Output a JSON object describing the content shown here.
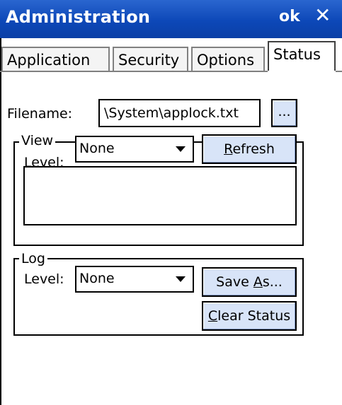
{
  "window": {
    "title": "Administration",
    "ok_label": "ok",
    "close_glyph": "✕"
  },
  "tabs": [
    {
      "label": "Application",
      "active": false
    },
    {
      "label": "Security",
      "active": false
    },
    {
      "label": "Options",
      "active": false
    },
    {
      "label": "Status",
      "active": true
    }
  ],
  "filename": {
    "label": "Filename:",
    "value": "\\System\\applock.txt",
    "browse_label": "..."
  },
  "view": {
    "legend": "View",
    "level_label": "Level:",
    "level_value": "None",
    "refresh_pre": "",
    "refresh_mnemonic": "R",
    "refresh_post": "efresh"
  },
  "log": {
    "legend": "Log",
    "level_label": "Level:",
    "level_value": "None",
    "save_pre": "Save ",
    "save_mnemonic": "A",
    "save_post": "s...",
    "clear_pre": "",
    "clear_mnemonic": "C",
    "clear_post": "lear Status"
  },
  "colors": {
    "titlebar": "#0d48b8",
    "button_face": "#d8e4f8"
  }
}
